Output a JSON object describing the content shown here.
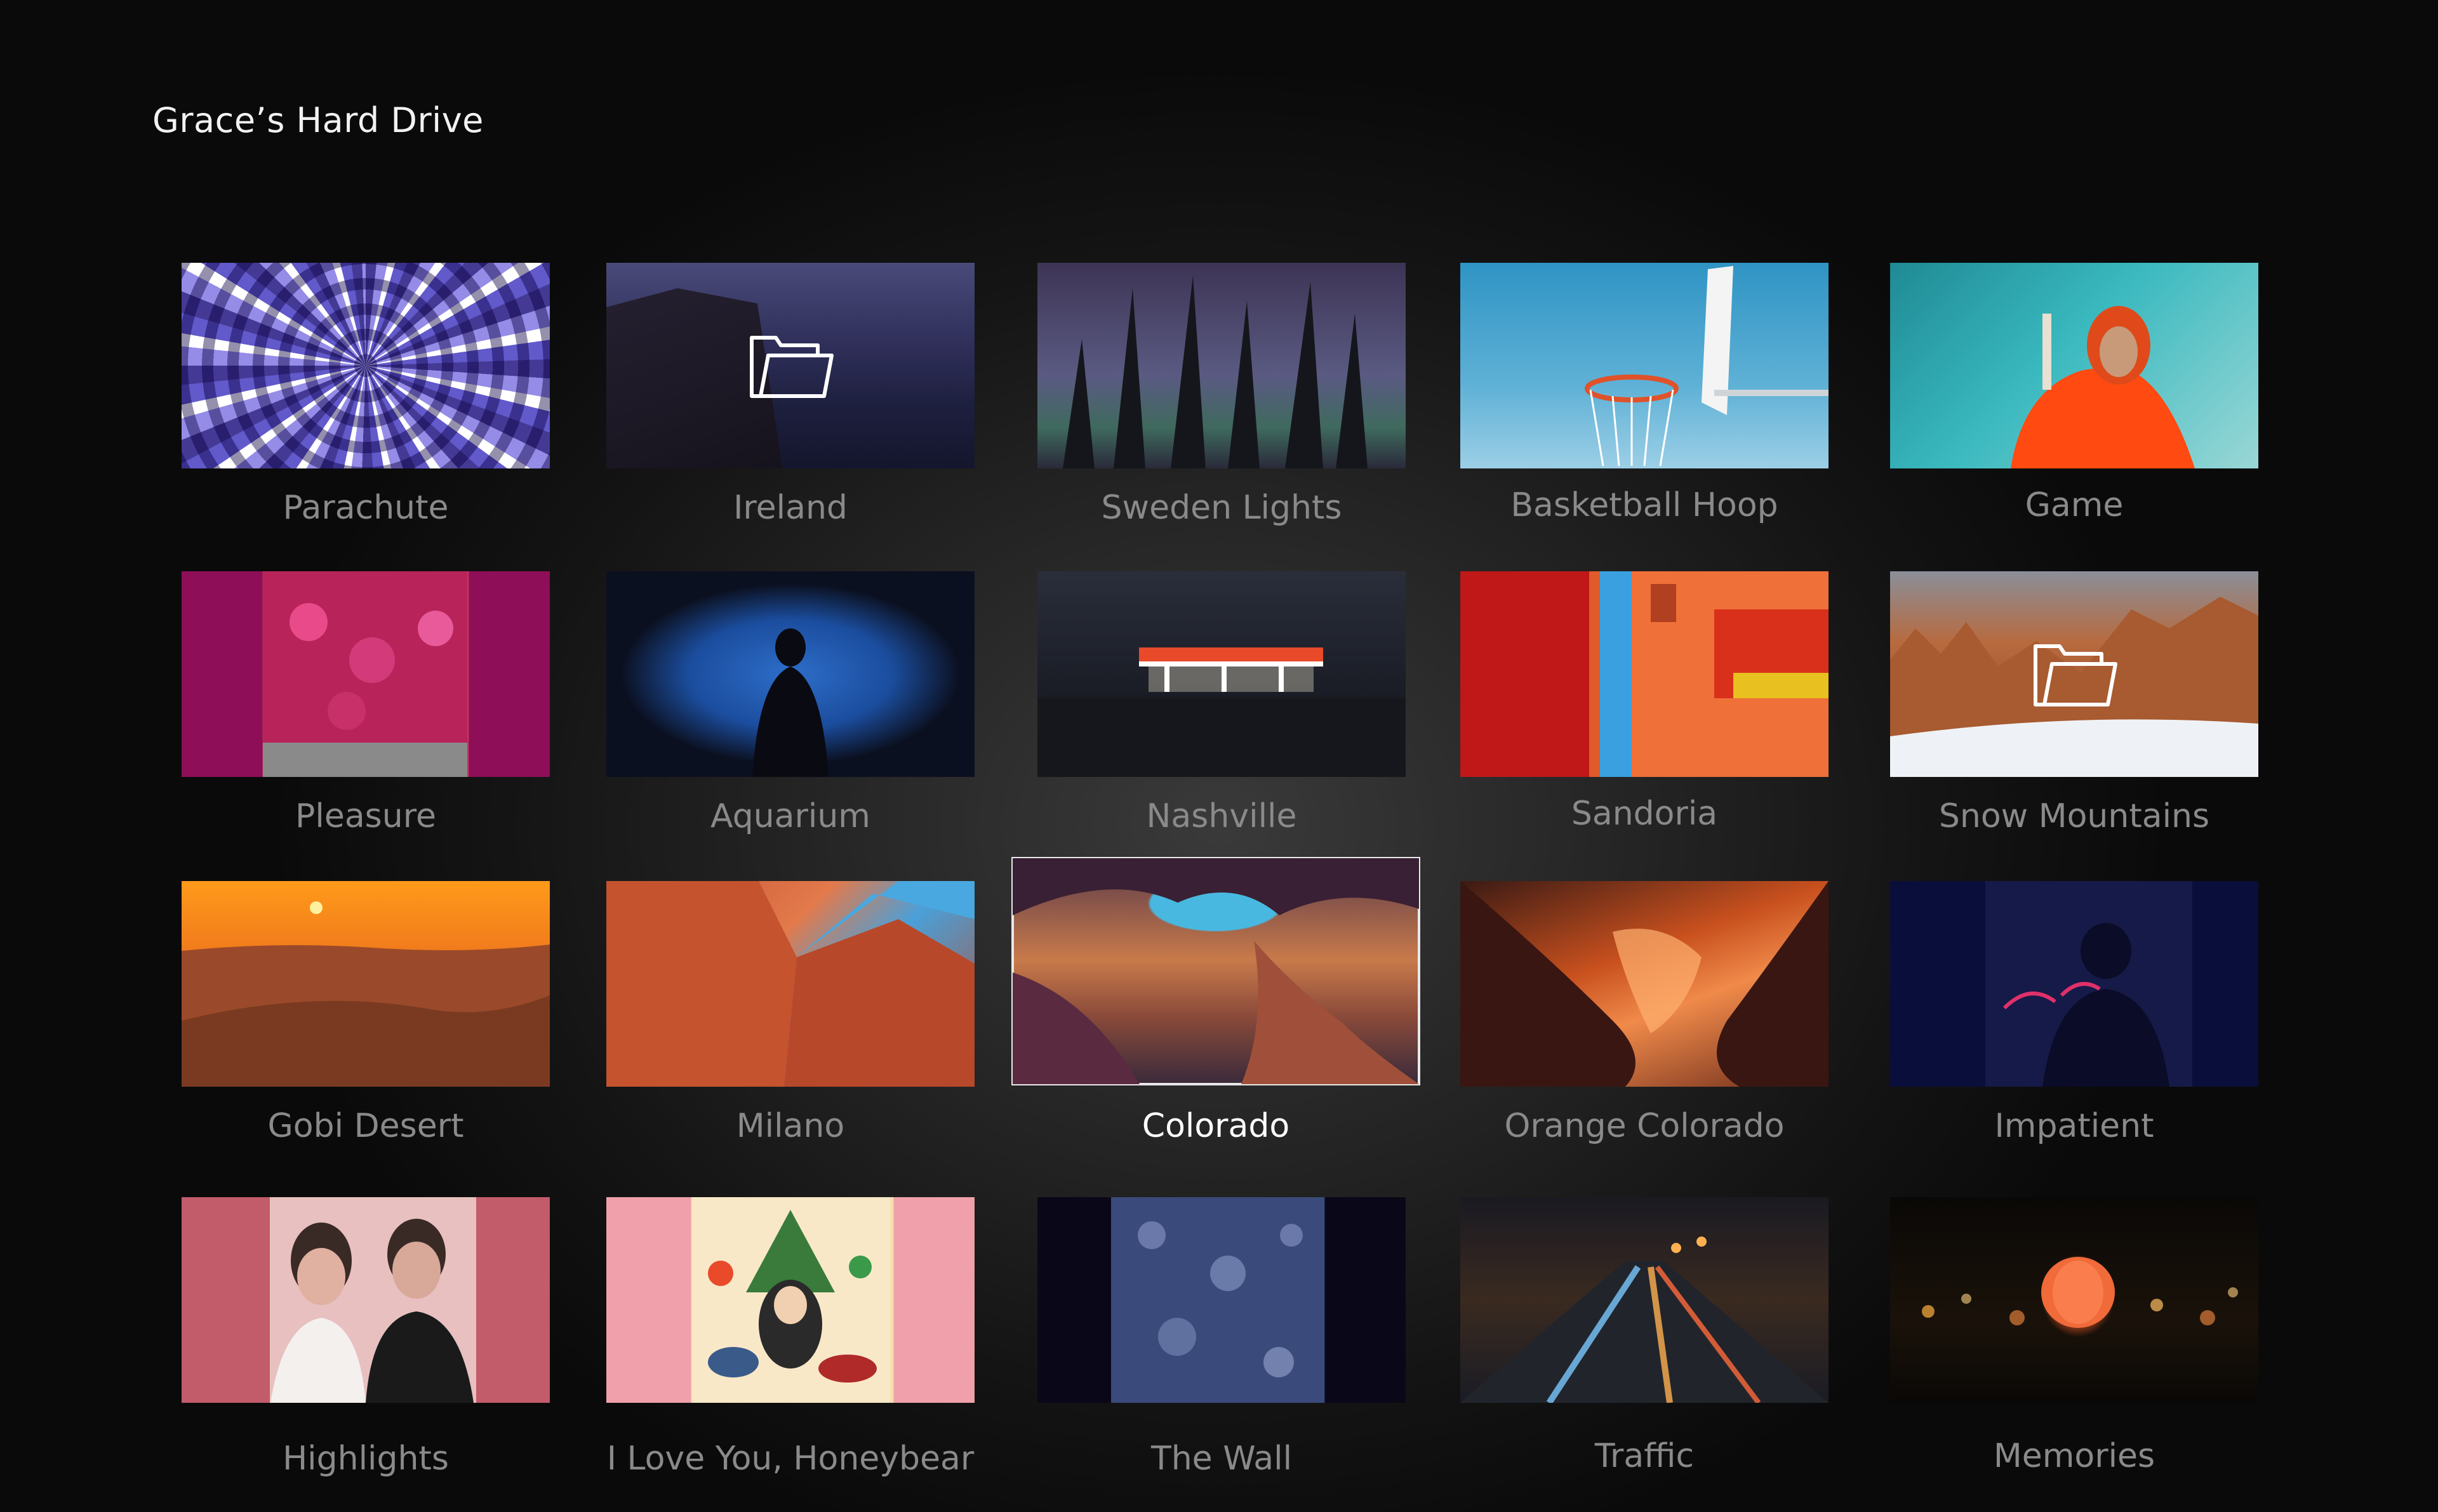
{
  "header": {
    "title": "Grace’s Hard Drive"
  },
  "tiles": [
    {
      "label": "Parachute",
      "thumbnail": "parachute-photo",
      "is_folder": false
    },
    {
      "label": "Ireland",
      "thumbnail": "cliffs-photo",
      "is_folder": true
    },
    {
      "label": "Sweden Lights",
      "thumbnail": "pine-trees-night-photo",
      "is_folder": false
    },
    {
      "label": "Basketball Hoop",
      "thumbnail": "basketball-hoop-photo",
      "is_folder": false
    },
    {
      "label": "Game",
      "thumbnail": "smoke-flare-photo",
      "is_folder": false
    },
    {
      "label": "Pleasure",
      "thumbnail": "flower-wall-photo",
      "is_folder": false
    },
    {
      "label": "Aquarium",
      "thumbnail": "aquarium-silhouette-photo",
      "is_folder": false
    },
    {
      "label": "Nashville",
      "thumbnail": "gas-station-photo",
      "is_folder": false
    },
    {
      "label": "Sandoria",
      "thumbnail": "red-building-photo",
      "is_folder": false
    },
    {
      "label": "Snow Mountains",
      "thumbnail": "canyon-snow-photo",
      "is_folder": true
    },
    {
      "label": "Gobi Desert",
      "thumbnail": "desert-sunset-photo",
      "is_folder": false
    },
    {
      "label": "Milano",
      "thumbnail": "buildings-sky-photo",
      "is_folder": false
    },
    {
      "label": "Colorado",
      "thumbnail": "antelope-canyon-photo",
      "is_folder": false,
      "focused": true
    },
    {
      "label": "Orange Colorado",
      "thumbnail": "orange-canyon-photo",
      "is_folder": false
    },
    {
      "label": "Impatient",
      "thumbnail": "album-cover-late-nights",
      "is_folder": false
    },
    {
      "label": "Highlights",
      "thumbnail": "album-cover-two-men",
      "is_folder": false
    },
    {
      "label": "I Love You, Honeybear",
      "thumbnail": "album-cover-illustration",
      "is_folder": false
    },
    {
      "label": "The Wall",
      "thumbnail": "blue-texture-photo",
      "is_folder": false
    },
    {
      "label": "Traffic",
      "thumbnail": "highway-night-photo",
      "is_folder": false
    },
    {
      "label": "Memories",
      "thumbnail": "lantern-bokeh-photo",
      "is_folder": false
    }
  ],
  "colors": {
    "background": "#141414",
    "label_default": "#8a8a8a",
    "label_focused": "#ffffff",
    "focus_border": "#e8e8e8"
  }
}
